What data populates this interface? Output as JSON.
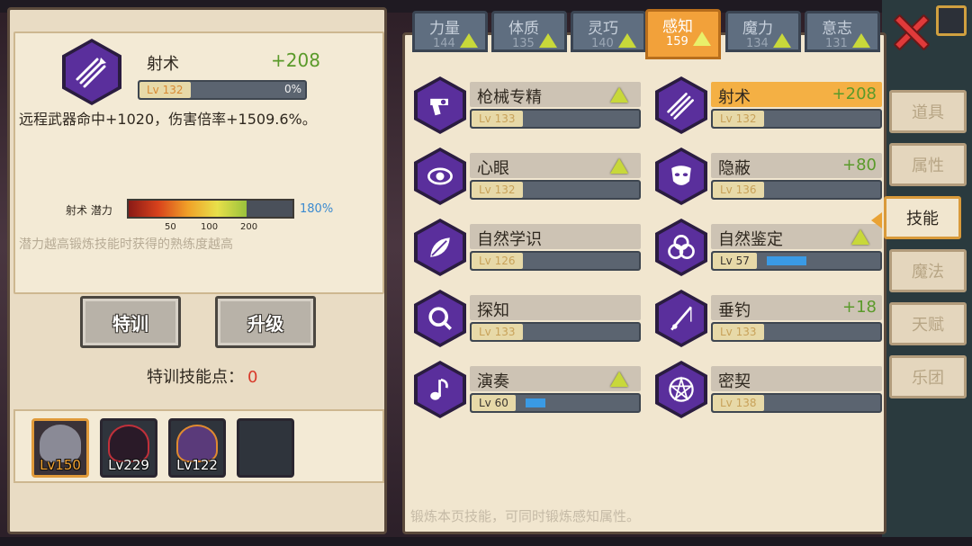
{
  "attribute_tabs": [
    {
      "name": "力量",
      "value": "144",
      "active": false
    },
    {
      "name": "体质",
      "value": "135",
      "active": false
    },
    {
      "name": "灵巧",
      "value": "140",
      "active": false
    },
    {
      "name": "感知",
      "value": "159",
      "active": true
    },
    {
      "name": "魔力",
      "value": "134",
      "active": false
    },
    {
      "name": "意志",
      "value": "131",
      "active": false
    }
  ],
  "detail": {
    "skill_name": "射术",
    "bonus": "+208",
    "level": "Lv 132",
    "progress_pct": "0%",
    "progress": 0.0,
    "description": "远程武器命中+1020，伤害倍率+1509.6%。",
    "potential_label": "射术 潜力",
    "potential_pct": "180%",
    "potential_fill": 0.72,
    "potential_ticks": [
      "50",
      "100",
      "200"
    ],
    "potential_hint": "潜力越高锻炼技能时获得的熟练度越高"
  },
  "actions": {
    "train_label": "特训",
    "upgrade_label": "升级",
    "points_label": "特训技能点：",
    "points_value": "0"
  },
  "party": [
    {
      "level": "Lv150",
      "selected": true
    },
    {
      "level": "Lv229",
      "selected": false
    },
    {
      "level": "Lv122",
      "selected": false
    },
    {
      "level": "",
      "selected": false
    }
  ],
  "skills": [
    {
      "name": "枪械专精",
      "level": "Lv 133",
      "bonus": "",
      "upgrade": true,
      "highlight": false,
      "progress": 0.0,
      "icon": "revolver-icon"
    },
    {
      "name": "射术",
      "level": "Lv 132",
      "bonus": "+208",
      "upgrade": false,
      "highlight": true,
      "progress": 0.0,
      "icon": "arrows-icon"
    },
    {
      "name": "心眼",
      "level": "Lv 132",
      "bonus": "",
      "upgrade": true,
      "highlight": false,
      "progress": 0.0,
      "icon": "eye-icon"
    },
    {
      "name": "隐蔽",
      "level": "Lv 136",
      "bonus": "+80",
      "upgrade": false,
      "highlight": false,
      "progress": 0.0,
      "icon": "mask-icon"
    },
    {
      "name": "自然学识",
      "level": "Lv 126",
      "bonus": "",
      "upgrade": false,
      "highlight": false,
      "progress": 0.0,
      "icon": "leaf-icon"
    },
    {
      "name": "自然鉴定",
      "level": "Lv 57",
      "bonus": "",
      "upgrade": true,
      "highlight": false,
      "progress": 0.37,
      "icon": "triquetra-icon"
    },
    {
      "name": "探知",
      "level": "Lv 133",
      "bonus": "",
      "upgrade": false,
      "highlight": false,
      "progress": 0.0,
      "icon": "magnifier-icon"
    },
    {
      "name": "垂钓",
      "level": "Lv 133",
      "bonus": "+18",
      "upgrade": false,
      "highlight": false,
      "progress": 0.0,
      "icon": "fishing-rod-icon"
    },
    {
      "name": "演奏",
      "level": "Lv 60",
      "bonus": "",
      "upgrade": true,
      "highlight": false,
      "progress": 0.18,
      "icon": "music-note-icon"
    },
    {
      "name": "密契",
      "level": "Lv 138",
      "bonus": "",
      "upgrade": false,
      "highlight": false,
      "progress": 0.0,
      "icon": "pentagram-icon"
    }
  ],
  "main_hint": "锻炼本页技能，可同时锻炼感知属性。",
  "side_tabs": [
    {
      "label": "道具",
      "active": false
    },
    {
      "label": "属性",
      "active": false
    },
    {
      "label": "技能",
      "active": true
    },
    {
      "label": "魔法",
      "active": false
    },
    {
      "label": "天赋",
      "active": false
    },
    {
      "label": "乐团",
      "active": false
    }
  ],
  "colors": {
    "panel_bg": "#f1e6cf",
    "active_tab": "#f2a13a",
    "bonus_green": "#5a9a2a",
    "skill_hex_purple": "#5a2f9c",
    "upgrade_arrow": "#c8d83a",
    "progress_blue": "#3a9ae4",
    "close_red": "#e03a3a"
  }
}
